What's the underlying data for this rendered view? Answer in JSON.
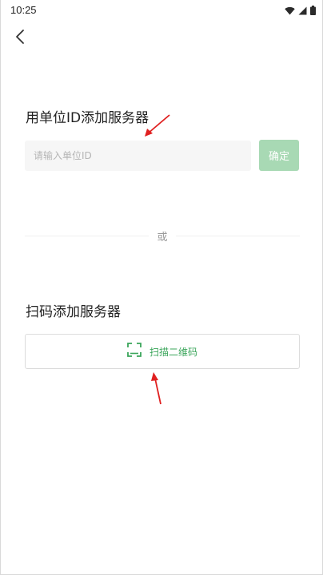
{
  "status_bar": {
    "time": "10:25",
    "icons": [
      "wifi-icon",
      "signal-icon",
      "battery-icon"
    ]
  },
  "nav": {
    "back_icon": "chevron-left-icon"
  },
  "unit_id_section": {
    "title": "用单位ID添加服务器",
    "input_placeholder": "请输入单位ID",
    "input_value": "",
    "confirm_label": "确定"
  },
  "divider": {
    "text": "或"
  },
  "scan_section": {
    "title": "扫码添加服务器",
    "button_label": "扫描二维码",
    "button_icon": "scan-frame-icon"
  },
  "colors": {
    "accent_green": "#3aa55a",
    "confirm_disabled": "#a8d9b4",
    "annotation_red": "#e02020"
  }
}
